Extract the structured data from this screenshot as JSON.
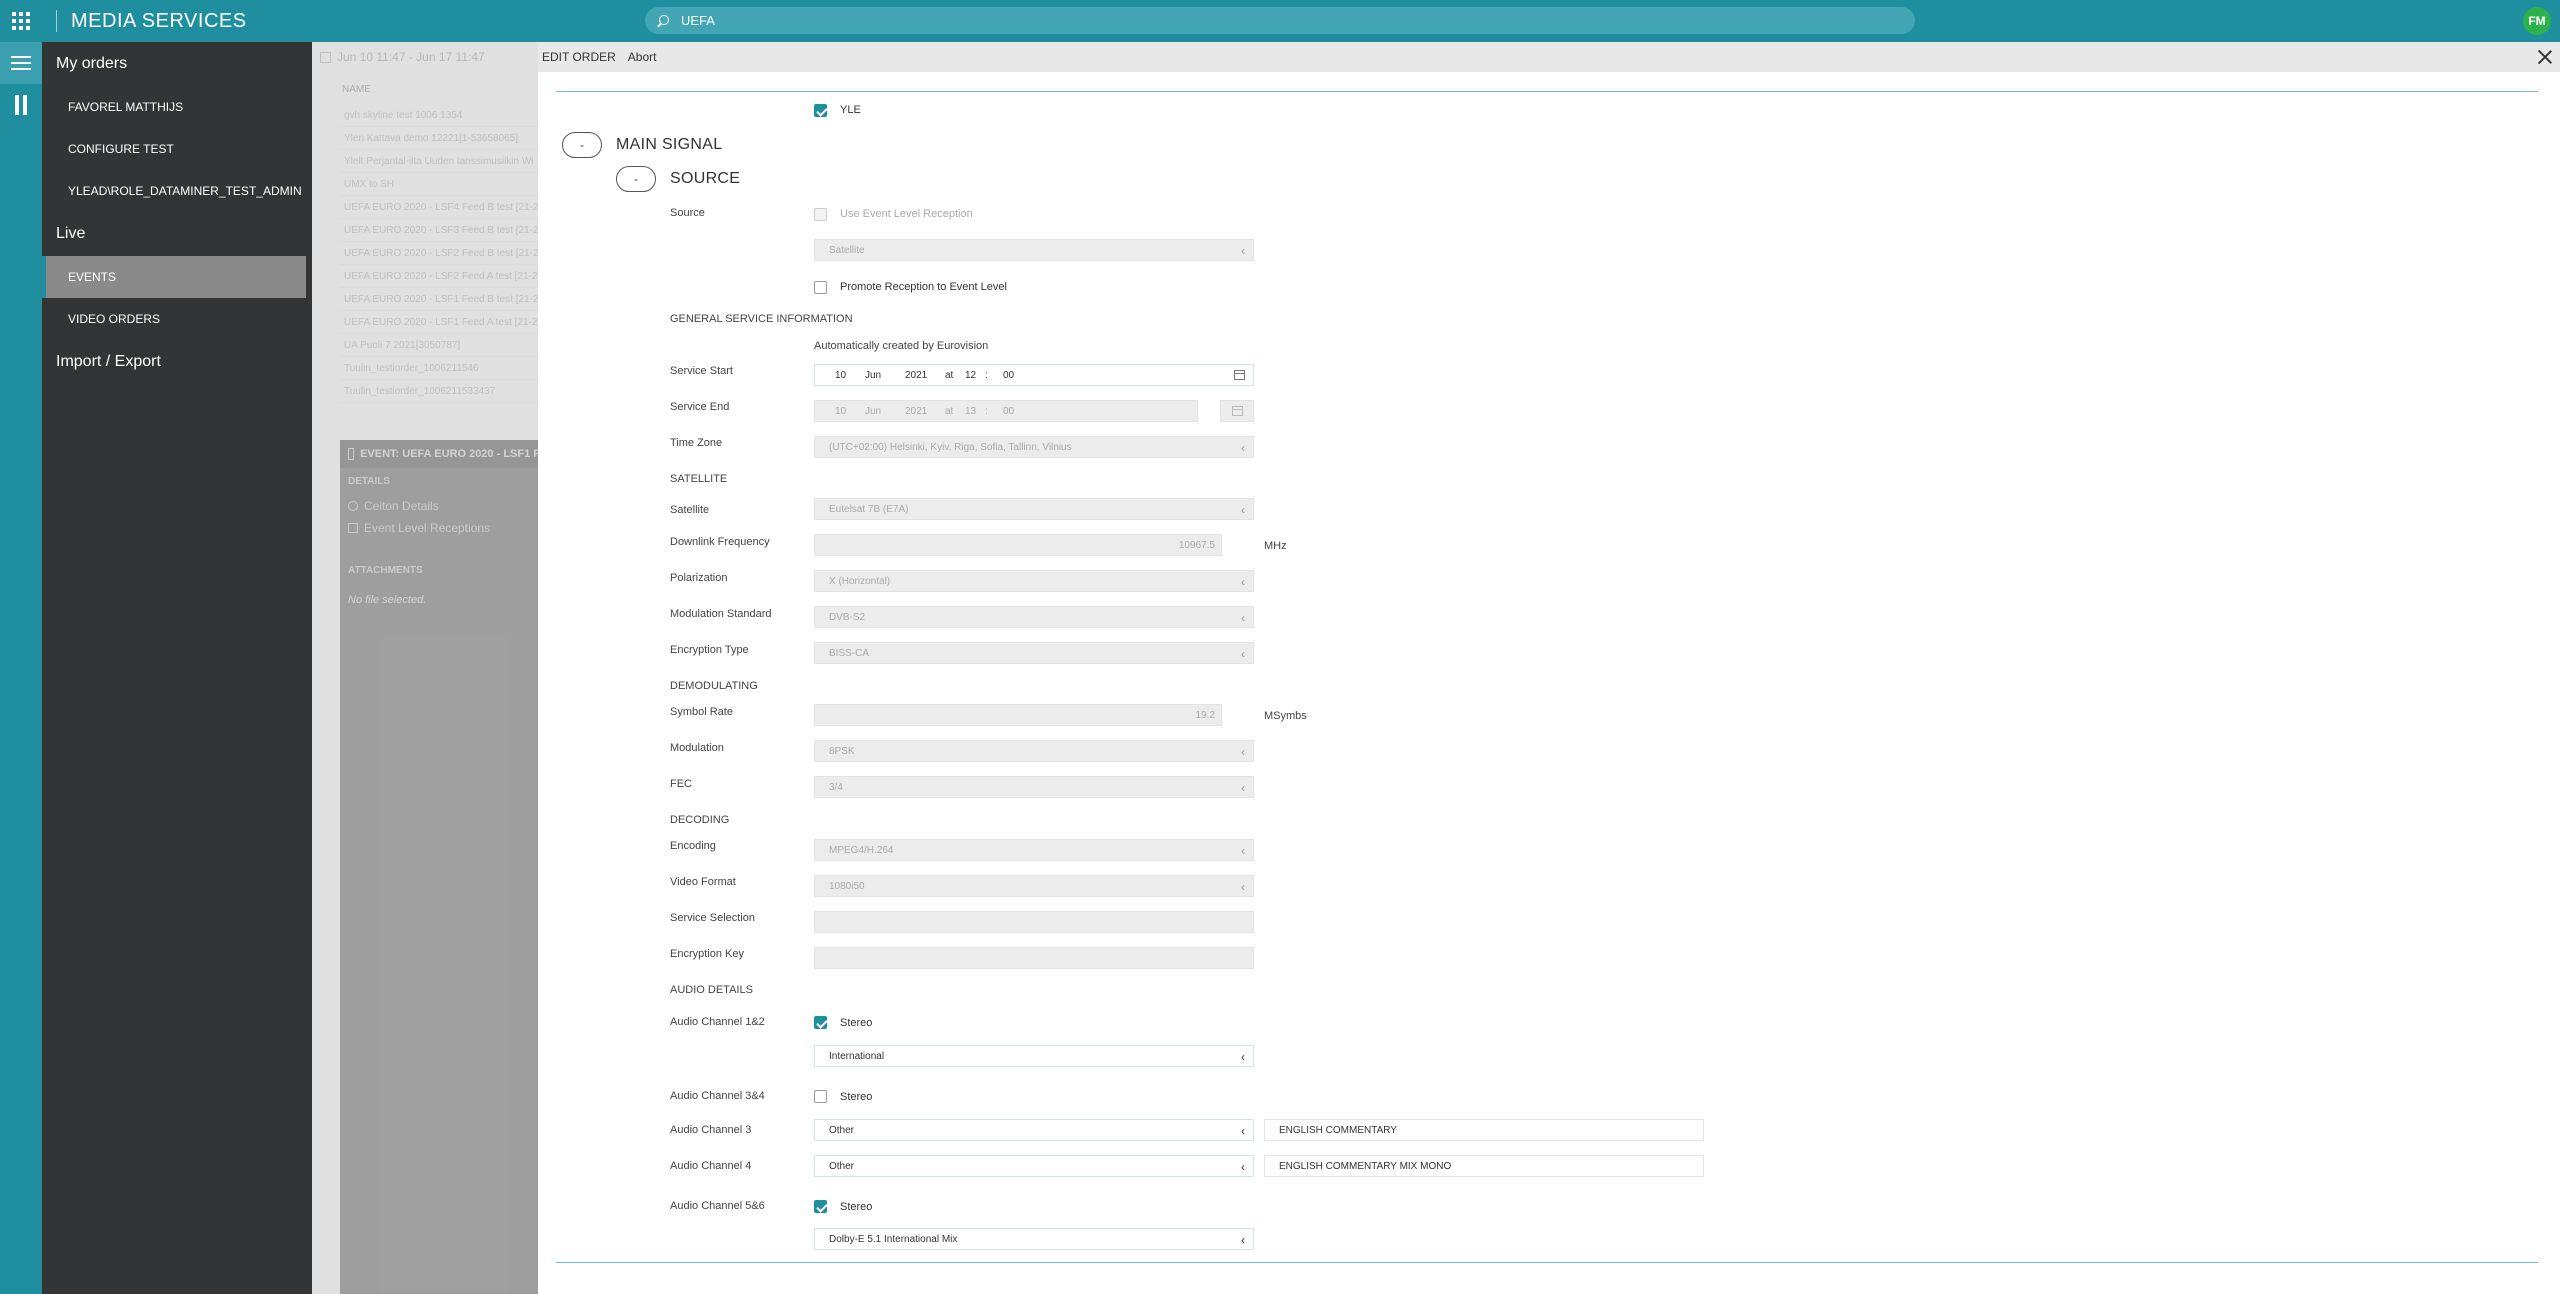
{
  "app": {
    "title": "MEDIA SERVICES",
    "search_value": "UEFA",
    "user_initials": "FM"
  },
  "nav": {
    "my_orders": "My orders",
    "order_items": [
      "FAVOREL MATTHIJS",
      "CONFIGURE TEST",
      "YLEAD\\ROLE_DATAMINER_TEST_ADMIN"
    ],
    "live": "Live",
    "live_items": [
      "EVENTS",
      "VIDEO ORDERS"
    ],
    "import_export": "Import / Export"
  },
  "background": {
    "date_range": "Jun 10 11:47 - Jun 17 11:47",
    "name_header": "NAME",
    "rows": [
      "gvh skyline test 1006 1354",
      "Ylen Kattava demo 12221[1-53658065]",
      "Ylelt Perjantal-ilta Uuden tanssimusiikin Wi",
      "UMX to SH",
      "UEFA EURO 2020 - LSF4 Feed B test [21-2",
      "UEFA EURO 2020 - LSF3 Feed B test [21-2",
      "UEFA EURO 2020 - LSF2 Feed B test [21-2",
      "UEFA EURO 2020 - LSF2 Feed A test [21-2",
      "UEFA EURO 2020 - LSF1 Feed B test [21-2",
      "UEFA EURO 2020 - LSF1 Feed A test [21-2",
      "UA Puoli 7 2021[3050787]",
      "Tuulin_testiorder_1006211546",
      "Tuulin_testiorder_1006211533437"
    ],
    "panel_title": "EVENT: UEFA EURO 2020 - LSF1 F",
    "details": "DETAILS",
    "ceiton_details": "Ceiton Details",
    "event_level_receptions": "Event Level Receptions",
    "attachments": "ATTACHMENTS",
    "no_file": "No file selected."
  },
  "edit": {
    "title": "EDIT ORDER",
    "abort": "Abort",
    "yle_label": "YLE",
    "main_signal": "MAIN SIGNAL",
    "source_section": "SOURCE",
    "collapse_symbol": "-",
    "source_label": "Source",
    "use_event_level_reception": "Use Event Level Reception",
    "source_value": "Satellite",
    "promote_reception": "Promote Reception to Event Level",
    "general_service_information": "GENERAL SERVICE INFORMATION",
    "auto_created": "Automatically created by Eurovision",
    "service_start_label": "Service Start",
    "service_start": {
      "day": "10",
      "month": "Jun",
      "year": "2021",
      "at": "at",
      "hour": "12",
      "colon": ":",
      "minute": "00"
    },
    "service_end_label": "Service End",
    "service_end": {
      "day": "10",
      "month": "Jun",
      "year": "2021",
      "at": "at",
      "hour": "13",
      "colon": ":",
      "minute": "00"
    },
    "time_zone_label": "Time Zone",
    "time_zone_value": "(UTC+02:00) Helsinki, Kyiv, Riga, Sofia, Tallinn, Vilnius",
    "satellite_section": "SATELLITE",
    "satellite_label": "Satellite",
    "satellite_value": "Eutelsat 7B (E7A)",
    "downlink_label": "Downlink Frequency",
    "downlink_value": "10967.5",
    "downlink_unit": "MHz",
    "polarization_label": "Polarization",
    "polarization_value": "X (Horizontal)",
    "modulation_standard_label": "Modulation Standard",
    "modulation_standard_value": "DVB-S2",
    "encryption_type_label": "Encryption Type",
    "encryption_type_value": "BISS-CA",
    "demodulating_section": "DEMODULATING",
    "symbol_rate_label": "Symbol Rate",
    "symbol_rate_value": "19.2",
    "symbol_rate_unit": "MSymbs",
    "modulation_label": "Modulation",
    "modulation_value": "8PSK",
    "fec_label": "FEC",
    "fec_value": "3/4",
    "decoding_section": "DECODING",
    "encoding_label": "Encoding",
    "encoding_value": "MPEG4/H.264",
    "video_format_label": "Video Format",
    "video_format_value": "1080i50",
    "service_selection_label": "Service Selection",
    "service_selection_value": "",
    "encryption_key_label": "Encryption Key",
    "encryption_key_value": "",
    "audio_details_section": "AUDIO DETAILS",
    "audio_12_label": "Audio Channel 1&2",
    "stereo": "Stereo",
    "audio_12_value": "International",
    "audio_34_label": "Audio Channel 3&4",
    "audio_3_label": "Audio Channel 3",
    "audio_3_value": "Other",
    "audio_3_desc": "ENGLISH COMMENTARY",
    "audio_4_label": "Audio Channel 4",
    "audio_4_value": "Other",
    "audio_4_desc": "ENGLISH COMMENTARY MIX MONO",
    "audio_56_label": "Audio Channel 5&6",
    "audio_56_value": "Dolby-E 5.1 International Mix"
  },
  "state": {
    "yle_checked": true,
    "use_event_level_reception_checked": false,
    "promote_checked": false,
    "audio_12_stereo": true,
    "audio_34_stereo": false,
    "audio_56_stereo": true
  },
  "colors": {
    "accent": "#1f8fa0",
    "avatar": "#2bb24c",
    "sidebar": "#333436"
  }
}
